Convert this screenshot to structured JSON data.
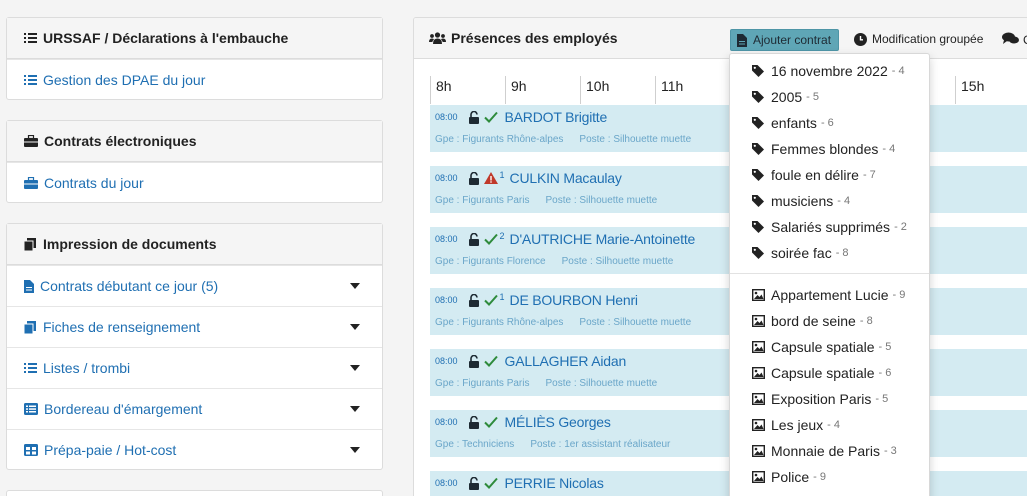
{
  "sidebar": {
    "urssaf": {
      "title": "URSSAF / Déclarations à l'embauche",
      "links": [
        "Gestion des DPAE du jour"
      ]
    },
    "contrats": {
      "title": "Contrats électroniques",
      "links": [
        "Contrats du jour"
      ]
    },
    "impression": {
      "title": "Impression de documents",
      "links": [
        "Contrats débutant ce jour (5)",
        "Fiches de renseignement",
        "Listes / trombi",
        "Bordereau d'émargement",
        "Prépa-paie / Hot-cost"
      ]
    }
  },
  "main": {
    "title": "Présences des employés",
    "add_button": "Ajouter contrat",
    "group_button": "Modification groupée",
    "comment_button": "C",
    "hours": [
      "8h",
      "9h",
      "10h",
      "11h",
      "15h"
    ]
  },
  "employees": [
    {
      "time": "08:00",
      "status": "check",
      "sup": "",
      "name": "BARDOT Brigitte",
      "group": "Gpe : Figurants Rhône-alpes",
      "post": "Poste : Silhouette muette"
    },
    {
      "time": "08:00",
      "status": "warning",
      "sup": "1",
      "name": "CULKIN Macaulay",
      "group": "Gpe : Figurants Paris",
      "post": "Poste : Silhouette muette"
    },
    {
      "time": "08:00",
      "status": "check",
      "sup": "2",
      "name": "D'AUTRICHE Marie-Antoinette",
      "group": "Gpe : Figurants Florence",
      "post": "Poste : Silhouette muette"
    },
    {
      "time": "08:00",
      "status": "check",
      "sup": "1",
      "name": "DE BOURBON Henri",
      "group": "Gpe : Figurants Rhône-alpes",
      "post": "Poste : Silhouette muette"
    },
    {
      "time": "08:00",
      "status": "check",
      "sup": "",
      "name": "GALLAGHER Aidan",
      "group": "Gpe : Figurants Paris",
      "post": "Poste : Silhouette muette"
    },
    {
      "time": "08:00",
      "status": "check",
      "sup": "",
      "name": "MÉLIÈS Georges",
      "group": "Gpe : Techniciens",
      "post": "Poste : 1er assistant réalisateur"
    },
    {
      "time": "08:00",
      "status": "check",
      "sup": "",
      "name": "PERRIE Nicolas",
      "group": "",
      "post": ""
    }
  ],
  "dropdown": {
    "tags": [
      {
        "label": "16 novembre 2022",
        "count": "- 4"
      },
      {
        "label": "2005",
        "count": "- 5"
      },
      {
        "label": "enfants",
        "count": "- 6"
      },
      {
        "label": "Femmes blondes",
        "count": "- 4"
      },
      {
        "label": "foule en délire",
        "count": "- 7"
      },
      {
        "label": "musiciens",
        "count": "- 4"
      },
      {
        "label": "Salariés supprimés",
        "count": "- 2"
      },
      {
        "label": "soirée fac",
        "count": "- 8"
      }
    ],
    "sets": [
      {
        "label": "Appartement Lucie",
        "count": "- 9"
      },
      {
        "label": "bord de seine",
        "count": "- 8"
      },
      {
        "label": "Capsule spatiale",
        "count": "- 5"
      },
      {
        "label": "Capsule spatiale",
        "count": "- 6"
      },
      {
        "label": "Exposition Paris",
        "count": "- 5"
      },
      {
        "label": "Les jeux",
        "count": "- 4"
      },
      {
        "label": "Monnaie de Paris",
        "count": "- 3"
      },
      {
        "label": "Police",
        "count": "- 9"
      }
    ]
  },
  "colors": {
    "link": "#1f6fb2",
    "row_bg": "#d4ebf2",
    "button_bg": "#5fa6b6",
    "check": "#2e8b3c",
    "warning": "#c0392b"
  }
}
